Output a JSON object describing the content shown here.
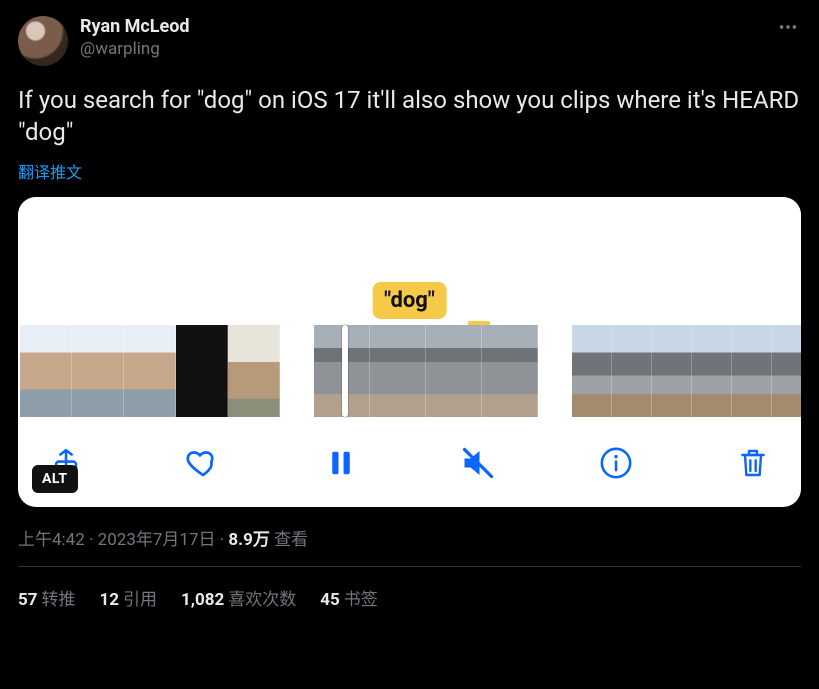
{
  "author": {
    "display_name": "Ryan McLeod",
    "handle": "@warpling"
  },
  "tweet": {
    "text": "If you search for \"dog\" on iOS 17 it'll also show you clips where it's HEARD \"dog\"",
    "translate_label": "翻译推文"
  },
  "media": {
    "search_term_label": "\"dog\"",
    "alt_badge": "ALT",
    "toolbar_icons": {
      "share": "share-icon",
      "like": "heart-icon",
      "pause": "pause-icon",
      "mute": "mute-icon",
      "info": "info-icon",
      "delete": "trash-icon"
    }
  },
  "meta": {
    "time": "上午4:42",
    "dot1": " · ",
    "date": "2023年7月17日",
    "dot2": " · ",
    "views_count": "8.9万",
    "views_label": " 查看"
  },
  "stats": {
    "retweets": {
      "count": "57",
      "label": "转推"
    },
    "quotes": {
      "count": "12",
      "label": "引用"
    },
    "likes": {
      "count": "1,082",
      "label": "喜欢次数"
    },
    "bookmarks": {
      "count": "45",
      "label": "书签"
    }
  }
}
